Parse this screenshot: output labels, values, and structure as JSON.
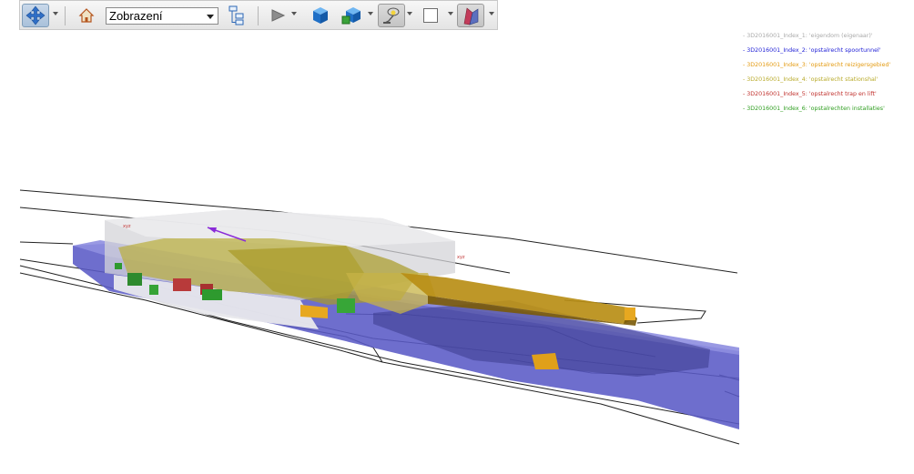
{
  "toolbar": {
    "view_select_value": "Zobrazení",
    "buttons": [
      {
        "name": "navigate-pan-icon"
      },
      {
        "name": "home-icon"
      },
      {
        "name": "tree-structure-icon"
      },
      {
        "name": "play-icon"
      },
      {
        "name": "solid-cube-icon"
      },
      {
        "name": "cubes-icon"
      },
      {
        "name": "lamp-icon"
      },
      {
        "name": "white-square-icon"
      },
      {
        "name": "section-icon"
      }
    ]
  },
  "legend": {
    "items": [
      {
        "label": "- 3D2016001_Index_1: 'eigendom (eigenaar)'",
        "color": "#a9a9a9"
      },
      {
        "label": "- 3D2016001_Index_2: 'opstalrecht spoortunnel'",
        "color": "#1f1fd6"
      },
      {
        "label": "- 3D2016001_Index_3: 'opstalrecht reizigersgebied'",
        "color": "#e39a10"
      },
      {
        "label": "- 3D2016001_Index_4: 'opstalrecht stationshal'",
        "color": "#b8aa2a"
      },
      {
        "label": "- 3D2016001_Index_5: 'opstalrecht trap en lift'",
        "color": "#c0302c"
      },
      {
        "label": "- 3D2016001_Index_6: 'opstalrechten installaties'",
        "color": "#2d9d1e"
      }
    ]
  },
  "scene": {
    "colors": {
      "tunnel": "#6b6bd0",
      "station_hall": "#c8b94a",
      "travel_area": "#b68a12",
      "owner": "#dcdce0",
      "stairs": "#b83a3a",
      "installations": "#2e9a2e"
    }
  }
}
